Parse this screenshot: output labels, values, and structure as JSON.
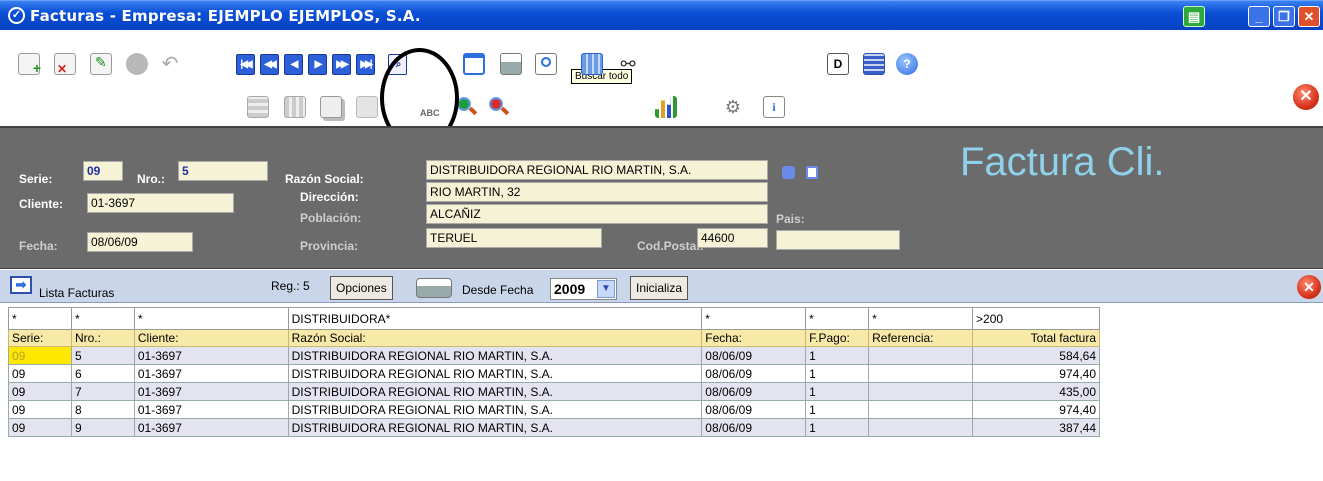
{
  "window": {
    "title": "Facturas - Empresa: EJEMPLO EJEMPLOS, S.A.",
    "title_icon": "check-circle-icon",
    "controls": [
      "printer-icon",
      "minimize-icon",
      "restore-icon",
      "close-icon"
    ]
  },
  "toolbar": {
    "tooltip": "Buscar todo",
    "row1_icons": [
      "new-record-icon",
      "delete-record-icon",
      "edit-icon",
      "save-icon",
      "undo-icon",
      "first-record-icon",
      "previous-page-icon",
      "previous-record-icon",
      "next-record-icon",
      "next-page-icon",
      "last-record-icon",
      "search-icon",
      "window-icon",
      "print-icon",
      "preview-icon",
      "find-all-icon",
      "binoculars-icon",
      "document-d-icon",
      "grid-icon",
      "help-icon"
    ],
    "row2_icons": [
      "insert-row-icon",
      "grid-edit-icon",
      "copy-icon",
      "paste-icon",
      "abc-spell-icon",
      "zoom-in-icon",
      "zoom-out-icon",
      "bar-chart-icon",
      "tools-icon",
      "info-icon"
    ],
    "exit_icon": "exit-icon"
  },
  "header": {
    "heading": "Factura Cli.",
    "serie_label": "Serie:",
    "serie_value": "09",
    "nro_label": "Nro.:",
    "nro_value": "5",
    "cliente_label": "Cliente:",
    "cliente_value": "01-3697",
    "fecha_label": "Fecha:",
    "fecha_value": "08/06/09",
    "razon_label": "Razón Social:",
    "razon_value": "DISTRIBUIDORA REGIONAL RIO MARTIN, S.A.",
    "direccion_label": "Dirección:",
    "direccion_value": "RIO MARTIN, 32",
    "poblacion_label": "Población:",
    "poblacion_value": "ALCAÑIZ",
    "provincia_label": "Provincia:",
    "provincia_value": "TERUEL",
    "cp_label": "Cod.Postal:",
    "cp_value": "44600",
    "pais_label": "Pais:",
    "pais_value": ""
  },
  "list": {
    "title": "Lista Facturas",
    "reg_label": "Reg.: 5",
    "opciones_label": "Opciones",
    "desde_label": "Desde Fecha",
    "desde_value": "2009",
    "inicializa_label": "Inicializa"
  },
  "filters": [
    "*",
    "*",
    "*",
    "DISTRIBUIDORA*",
    "*",
    "*",
    "*",
    ">200"
  ],
  "columns": [
    "Serie:",
    "Nro.:",
    "Cliente:",
    "Razón Social:",
    "Fecha:",
    "F.Pago:",
    "Referencia:",
    "Total factura"
  ],
  "rows": [
    [
      "09",
      "5",
      "01-3697",
      "DISTRIBUIDORA REGIONAL RIO MARTIN, S.A.",
      "08/06/09",
      "1",
      "",
      "584,64"
    ],
    [
      "09",
      "6",
      "01-3697",
      "DISTRIBUIDORA REGIONAL RIO MARTIN, S.A.",
      "08/06/09",
      "1",
      "",
      "974,40"
    ],
    [
      "09",
      "7",
      "01-3697",
      "DISTRIBUIDORA REGIONAL RIO MARTIN, S.A.",
      "08/06/09",
      "1",
      "",
      "435,00"
    ],
    [
      "09",
      "8",
      "01-3697",
      "DISTRIBUIDORA REGIONAL RIO MARTIN, S.A.",
      "08/06/09",
      "1",
      "",
      "974,40"
    ],
    [
      "09",
      "9",
      "01-3697",
      "DISTRIBUIDORA REGIONAL RIO MARTIN, S.A.",
      "08/06/09",
      "1",
      "",
      "387,44"
    ]
  ]
}
